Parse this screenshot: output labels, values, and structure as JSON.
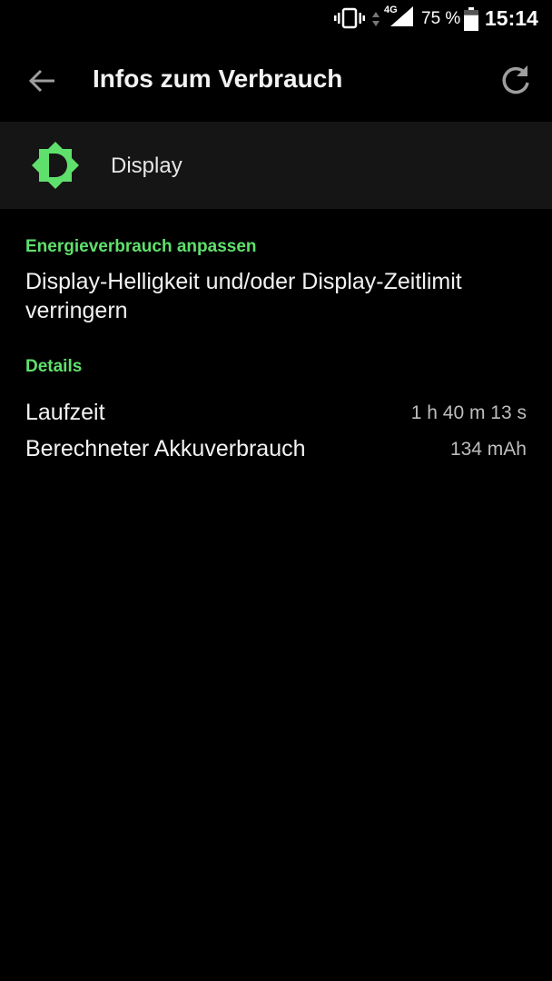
{
  "status_bar": {
    "network": "4G",
    "battery_percent": "75 %",
    "time": "15:14",
    "battery_level": 0.75,
    "icons": [
      "vibrate-icon",
      "data-arrows-icon",
      "signal-icon",
      "battery-icon"
    ]
  },
  "toolbar": {
    "title": "Infos zum Verbrauch",
    "back_icon": "arrow-back-icon",
    "refresh_icon": "refresh-icon"
  },
  "header": {
    "title": "Display",
    "icon": "brightness-icon",
    "icon_color": "#5fe06c"
  },
  "energy": {
    "heading": "Energieverbrauch anpassen",
    "text": "Display-Helligkeit und/oder Display-Zeitlimit verringern"
  },
  "details": {
    "heading": "Details",
    "rows": [
      {
        "label": "Laufzeit",
        "value": "1 h 40 m 13 s"
      },
      {
        "label": "Berechneter Akkuverbrauch",
        "value": "134 mAh"
      }
    ]
  },
  "colors": {
    "accent": "#5fe06c",
    "background": "#000000",
    "card": "#151515"
  }
}
